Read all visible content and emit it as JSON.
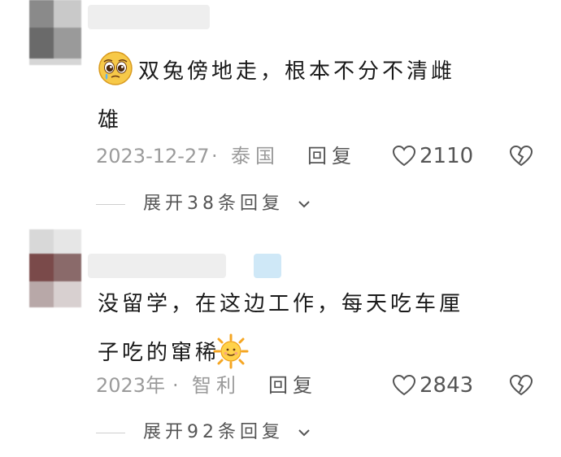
{
  "comments": [
    {
      "text_line1": "双兔傍地走，根本不分不清雌",
      "text_line2": "雄",
      "date": "2023-12-27",
      "dot": "·",
      "location": "泰国",
      "reply_label": "回复",
      "likes": "2110",
      "expand_label": "展开38条回复",
      "emoji": "pleading-face-icon"
    },
    {
      "text_line1": "没留学，在这边工作，每天吃车厘",
      "text_line2": "子吃的窜稀",
      "date": "2023年",
      "dot": "·",
      "location": "智利",
      "reply_label": "回复",
      "likes": "2843",
      "expand_label": "展开92条回复",
      "emoji": "sun-face-icon"
    }
  ],
  "colors": {
    "meta_gray": "#9b9b9b",
    "text": "#1a1a1a"
  }
}
